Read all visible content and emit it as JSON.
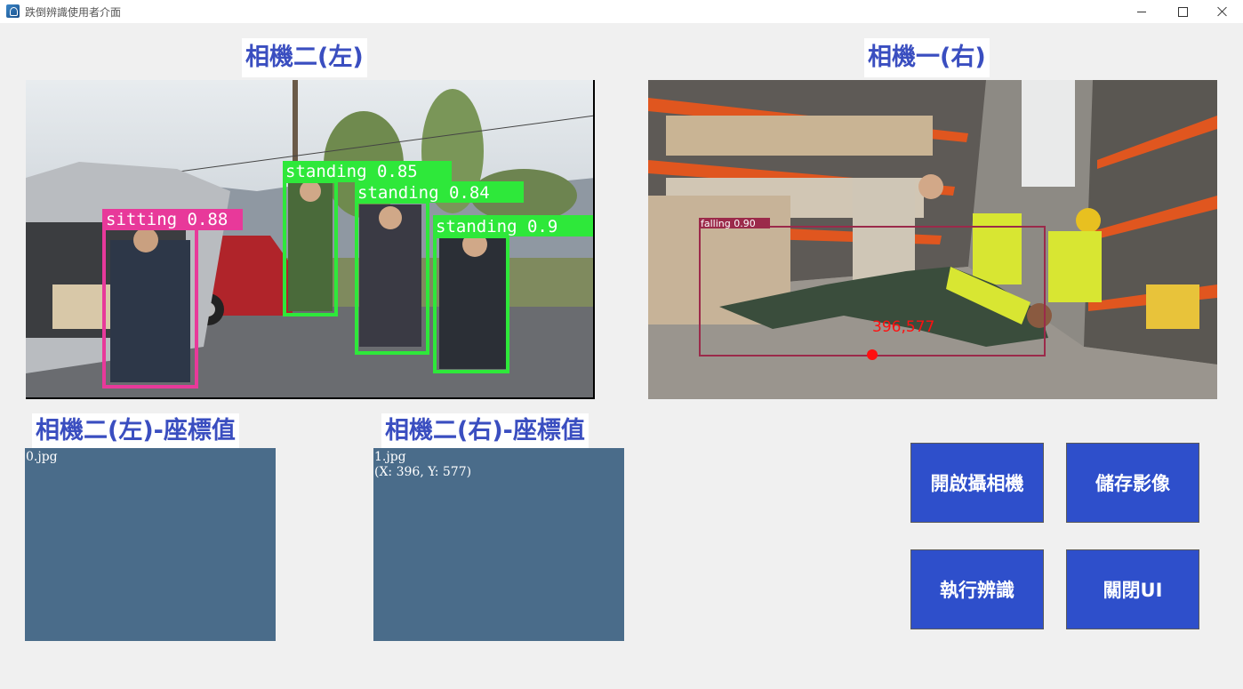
{
  "window": {
    "title": "跌倒辨識使用者介面",
    "minimize_label": "—",
    "maximize_label": "□",
    "close_label": "✕"
  },
  "cameras": {
    "left": {
      "title": "相機二(左)",
      "detections": [
        {
          "label": "sitting 0.88",
          "color": "#e8399a"
        },
        {
          "label": "standing 0.85",
          "color": "#2ee83a"
        },
        {
          "label": "standing 0.84",
          "color": "#2ee83a"
        },
        {
          "label": "standing 0.9",
          "color": "#2ee83a"
        }
      ]
    },
    "right": {
      "title": "相機一(右)",
      "detections": [
        {
          "label": "falling 0.90",
          "color": "#9b2a4a"
        }
      ],
      "point_label": "396,577",
      "point_color": "#ff1010"
    }
  },
  "coords": {
    "left": {
      "title": "相機二(左)-座標值",
      "lines": [
        "0.jpg"
      ]
    },
    "right": {
      "title": "相機二(右)-座標值",
      "lines": [
        "1.jpg",
        "(X: 396, Y: 577)"
      ]
    }
  },
  "buttons": {
    "open_camera": "開啟攝相機",
    "save_image": "儲存影像",
    "run_detection": "執行辨識",
    "close_ui": "關閉UI"
  },
  "colors": {
    "accent": "#2e4fcb",
    "title_text": "#3a4ec0",
    "coord_panel": "#4a6c8a"
  }
}
